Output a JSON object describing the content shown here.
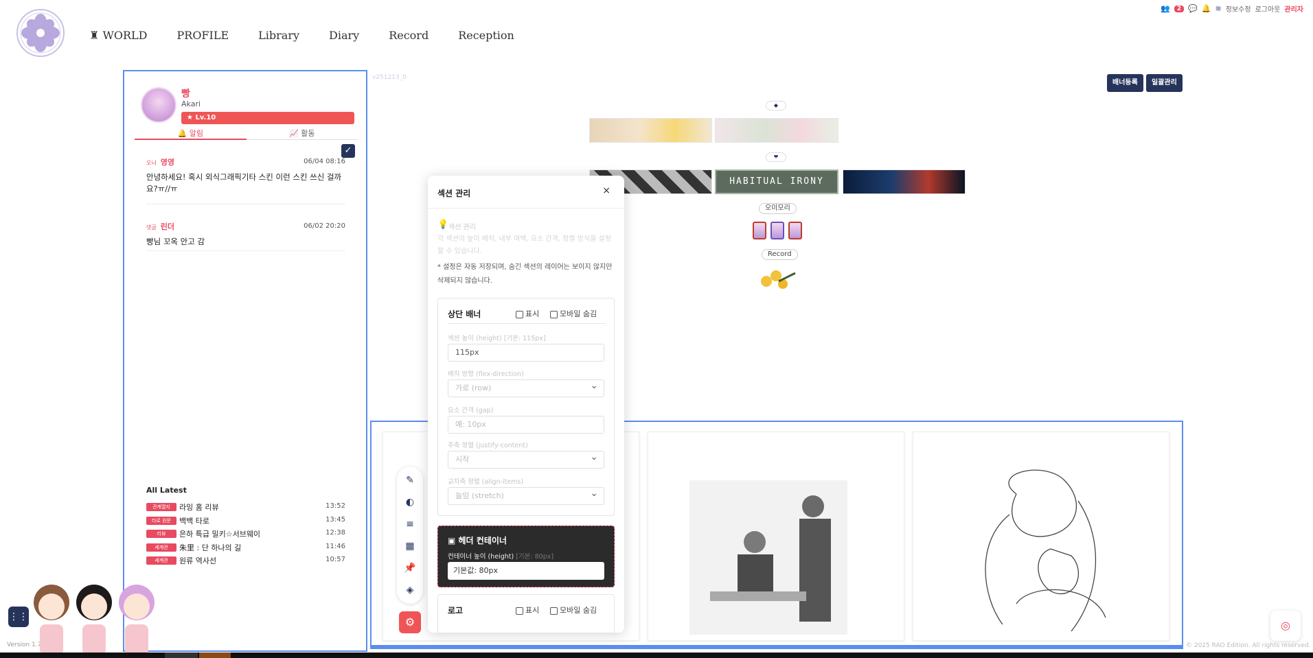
{
  "topbar": {
    "count": "2",
    "links": [
      "정보수정",
      "로그아웃"
    ],
    "admin": "관리자"
  },
  "nav": {
    "items": [
      "WORLD",
      "PROFILE",
      "Library",
      "Diary",
      "Record",
      "Reception"
    ]
  },
  "profile": {
    "name": "빵",
    "sub": "Akari",
    "level": "Lv.10",
    "tab_alarm": "알림",
    "tab_activity": "활동"
  },
  "notifications": [
    {
      "tag": "오너",
      "who": "영영",
      "date": "06/04 08:16",
      "msg": "안녕하세요! 혹시 외식그래픽기타 스킨 이런 스킨 쓰신 걸까요?ㅠ//ㅠ"
    },
    {
      "tag": "댓글",
      "who": "린더",
      "date": "06/02 20:20",
      "msg": "빵님 꼬옥 안고 감"
    }
  ],
  "latest": {
    "title": "All Latest",
    "items": [
      {
        "cat": "관계열지",
        "title": "라잉 홈 리뷰",
        "time": "13:52"
      },
      {
        "cat": "타로 원문",
        "title": "백백 타로",
        "time": "13:45"
      },
      {
        "cat": "리뷰",
        "title": "은하 특급 밀키☆서브웨이",
        "time": "12:38"
      },
      {
        "cat": "세계관",
        "title": "朱里 : 단 하나의 길",
        "time": "11:46"
      },
      {
        "cat": "세계관",
        "title": "원류 역사선",
        "time": "10:57"
      }
    ]
  },
  "version": "Version 1.70",
  "main": {
    "vtag": "v251213_0",
    "btn_banner": "배너등록",
    "btn_bulk": "일괄관리",
    "divider1": "◆",
    "divider2": "❤",
    "banner_text": "HABITUAL IRONY",
    "pill1": "오미모리",
    "pill2": "Record"
  },
  "modal": {
    "title": "섹션 관리",
    "close": "×",
    "hint_title": "섹션 관리",
    "hint_body": "각 섹션의 높이 배치, 내부 여백, 요소 간격, 정렬 방식을 설정할 수 있습니다.",
    "note": "* 설정은 자동 저장되며, 숨긴 섹션의 레이어는 보이지 않지만 삭제되지 않습니다.",
    "section1": {
      "title": "상단 배너",
      "show": "표시",
      "mobile_hide": "모바일 숨김",
      "height_label": "섹션 높이 (height)",
      "height_hint": "[기본: 115px]",
      "height_value": "115px",
      "direction_label": "배치 방향 (flex-direction)",
      "direction_value": "가로 (row)",
      "gap_label": "요소 간격 (gap)",
      "gap_placeholder": "예: 10px",
      "justify_label": "주축 정렬 (justify-content)",
      "justify_value": "시작",
      "align_label": "교차축 정렬 (align-items)",
      "align_value": "늘임 (stretch)"
    },
    "section2": {
      "title": "헤더 컨테이너",
      "label": "컨테이너 높이 (height)",
      "hint": "[기본: 80px]",
      "value": "기본값: 80px"
    },
    "section3": {
      "title": "로고",
      "show": "표시",
      "mobile_hide": "모바일 숨김"
    }
  },
  "footer": {
    "copyright": "© 2025 RAO Edition. All rights reserved."
  },
  "colors": {
    "accent": "#e84a5f",
    "navy": "#26345c",
    "border_blue": "#5b8def"
  }
}
